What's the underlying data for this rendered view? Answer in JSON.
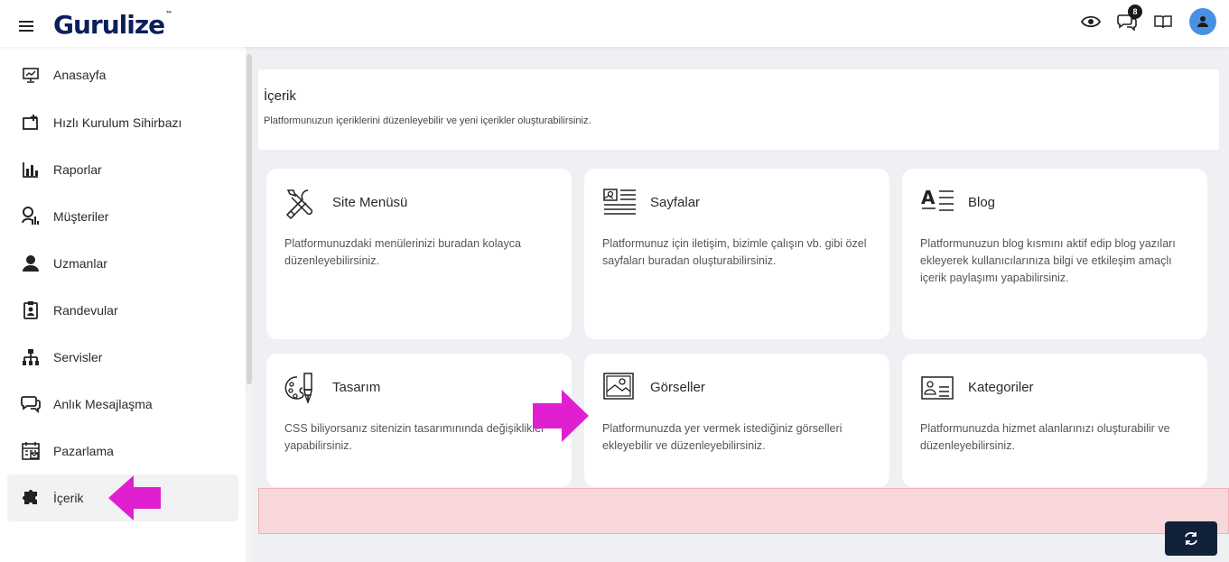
{
  "app": {
    "logo_text": "Gurulize",
    "logo_mark": "™",
    "notification_count": "8"
  },
  "sidebar": {
    "items": [
      {
        "label": "Anasayfa",
        "icon": "presentation-monitor-icon"
      },
      {
        "label": "Hızlı Kurulum Sihirbazı",
        "icon": "quick-setup-icon"
      },
      {
        "label": "Raporlar",
        "icon": "bar-chart-icon"
      },
      {
        "label": "Müşteriler",
        "icon": "customers-icon"
      },
      {
        "label": "Uzmanlar",
        "icon": "user-icon"
      },
      {
        "label": "Randevular",
        "icon": "clipboard-user-icon"
      },
      {
        "label": "Servisler",
        "icon": "sitemap-icon"
      },
      {
        "label": "Anlık Mesajlaşma",
        "icon": "chat-icon"
      },
      {
        "label": "Pazarlama",
        "icon": "marketing-calendar-icon"
      },
      {
        "label": "İçerik",
        "icon": "puzzle-icon",
        "active": true
      }
    ]
  },
  "header": {
    "title": "İçerik",
    "subtitle": "Platformunuzun içeriklerini düzenleyebilir ve yeni içerikler oluşturabilirsiniz."
  },
  "cards": [
    {
      "title": "Site Menüsü",
      "desc": "Platformunuzdaki menülerinizi buradan kolayca düzenleyebilirsiniz.",
      "icon": "tools-icon"
    },
    {
      "title": "Sayfalar",
      "desc": "Platformunuz için iletişim, bizimle çalışın vb. gibi özel sayfaları buradan oluşturabilirsiniz.",
      "icon": "pages-icon"
    },
    {
      "title": "Blog",
      "desc": "Platformunuzun blog kısmını aktif edip blog yazıları ekleyerek kullanıcılarınıza bilgi ve etkileşim amaçlı içerik paylaşımı yapabilirsiniz.",
      "icon": "text-format-icon"
    },
    {
      "title": "Tasarım",
      "desc": "CSS biliyorsanız sitenizin tasarımınında değişiklikler yapabilirsiniz.",
      "icon": "design-palette-icon"
    },
    {
      "title": "Görseller",
      "desc": "Platformunuzda yer vermek istediğiniz görselleri ekleyebilir ve düzenleyebilirsiniz.",
      "icon": "image-icon"
    },
    {
      "title": "Kategoriler",
      "desc": "Platformunuzda hizmet alanlarınızı oluşturabilir ve düzenleyebilirsiniz.",
      "icon": "id-card-icon"
    }
  ],
  "colors": {
    "accent_arrow": "#e020d0",
    "alert_bg": "#f8d7da",
    "refresh_btn": "#12213a"
  }
}
